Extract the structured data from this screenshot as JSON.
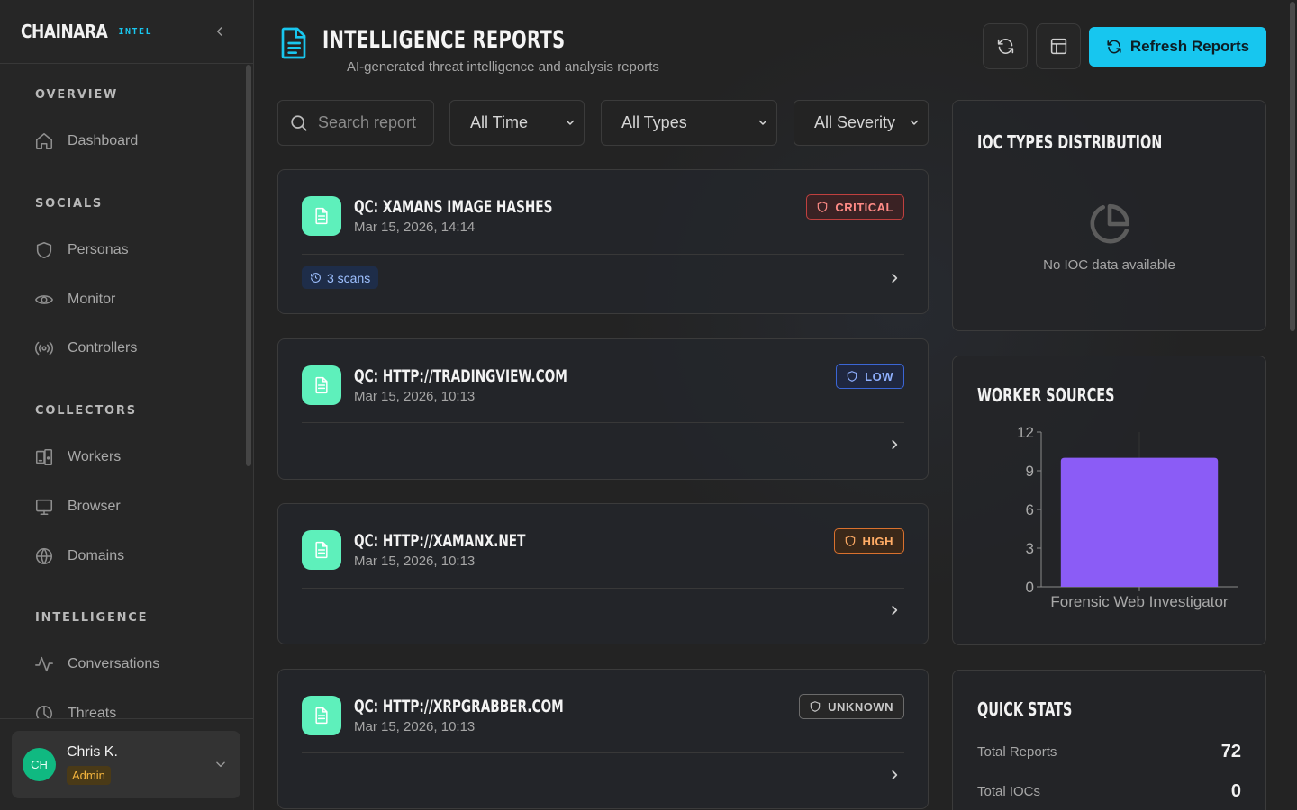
{
  "brand": {
    "name": "CHAINARA",
    "tag": "INTEL"
  },
  "sidebar": {
    "sections": [
      {
        "label": "OVERVIEW",
        "items": [
          {
            "label": "Dashboard",
            "icon": "home-icon"
          }
        ]
      },
      {
        "label": "SOCIALS",
        "items": [
          {
            "label": "Personas",
            "icon": "shield-icon"
          },
          {
            "label": "Monitor",
            "icon": "eye-icon"
          },
          {
            "label": "Controllers",
            "icon": "radio-icon"
          }
        ]
      },
      {
        "label": "COLLECTORS",
        "items": [
          {
            "label": "Workers",
            "icon": "devices-icon"
          },
          {
            "label": "Browser",
            "icon": "monitor-icon"
          },
          {
            "label": "Domains",
            "icon": "globe-icon"
          }
        ]
      },
      {
        "label": "INTELLIGENCE",
        "items": [
          {
            "label": "Conversations",
            "icon": "activity-icon"
          },
          {
            "label": "Threats",
            "icon": "threat-icon"
          }
        ]
      }
    ]
  },
  "user": {
    "initials": "CH",
    "name": "Chris K.",
    "role": "Admin",
    "avatar_color": "#10b981"
  },
  "header": {
    "title": "INTELLIGENCE REPORTS",
    "subtitle": "AI-generated threat intelligence and analysis reports",
    "refresh_label": "Refresh Reports",
    "accent": "#17c6ef"
  },
  "filters": {
    "search_placeholder": "Search report",
    "time": "All Time",
    "type": "All Types",
    "severity": "All Severity"
  },
  "reports": [
    {
      "title": "QC: XAMANS IMAGE HASHES",
      "date": "Mar 15, 2026, 14:14",
      "severity": "CRITICAL",
      "scans": "3 scans"
    },
    {
      "title": "QC: HTTP://TRADINGVIEW.COM",
      "date": "Mar 15, 2026, 10:13",
      "severity": "LOW"
    },
    {
      "title": "QC: HTTP://XAMANX.NET",
      "date": "Mar 15, 2026, 10:13",
      "severity": "HIGH"
    },
    {
      "title": "QC: HTTP://XRPGRABBER.COM",
      "date": "Mar 15, 2026, 10:13",
      "severity": "UNKNOWN"
    }
  ],
  "ioc_panel": {
    "title": "IOC TYPES DISTRIBUTION",
    "empty_text": "No IOC data available"
  },
  "worker_panel": {
    "title": "WORKER SOURCES"
  },
  "chart_data": {
    "type": "bar",
    "categories": [
      "Forensic Web Investigator"
    ],
    "values": [
      10
    ],
    "ylim": [
      0,
      12
    ],
    "yticks": [
      "0",
      "3",
      "6",
      "9",
      "12"
    ],
    "bar_color": "#8b5cf6",
    "grid": false
  },
  "quick_stats": {
    "title": "QUICK STATS",
    "rows": [
      {
        "label": "Total Reports",
        "value": "72"
      },
      {
        "label": "Total IOCs",
        "value": "0"
      }
    ]
  }
}
